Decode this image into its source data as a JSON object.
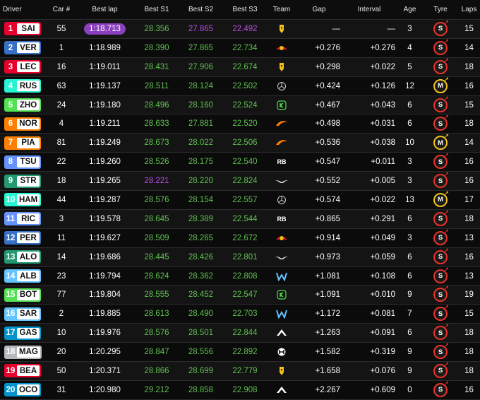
{
  "headers": {
    "driver": "Driver",
    "car": "Car #",
    "best_lap": "Best lap",
    "best_s1": "Best S1",
    "best_s2": "Best S2",
    "best_s3": "Best S3",
    "team": "Team",
    "gap": "Gap",
    "interval": "Interval",
    "age": "Age",
    "tyre": "Tyre",
    "laps": "Laps"
  },
  "team_colors": {
    "ferrari": "#e8002d",
    "redbull": "#3671c6",
    "mercedes": "#27f4d2",
    "sauber": "#52e252",
    "mclaren": "#ff8000",
    "rb": "#6692ff",
    "aston": "#229971",
    "williams": "#64c4ff",
    "alpine": "#0093cc",
    "haas": "#b6babd"
  },
  "rows": [
    {
      "pos": "1",
      "code": "SAI",
      "team": "ferrari",
      "team_icon": "ferrari-icon",
      "car": "55",
      "lap": "1:18.713",
      "lap_fastest": true,
      "s1": "28.356",
      "s1_c": "green",
      "s2": "27.865",
      "s2_c": "purple",
      "s3": "22.492",
      "s3_c": "purple",
      "gap": "—",
      "interval": "—",
      "age": "3",
      "tyre": "S",
      "tyre_type": "soft",
      "laps": "15"
    },
    {
      "pos": "2",
      "code": "VER",
      "team": "redbull",
      "team_icon": "redbull-icon",
      "car": "1",
      "lap": "1:18.989",
      "lap_fastest": false,
      "s1": "28.390",
      "s1_c": "green",
      "s2": "27.865",
      "s2_c": "green",
      "s3": "22.734",
      "s3_c": "green",
      "gap": "+0.276",
      "interval": "+0.276",
      "age": "4",
      "tyre": "S",
      "tyre_type": "soft",
      "laps": "14"
    },
    {
      "pos": "3",
      "code": "LEC",
      "team": "ferrari",
      "team_icon": "ferrari-icon",
      "car": "16",
      "lap": "1:19.011",
      "lap_fastest": false,
      "s1": "28.431",
      "s1_c": "green",
      "s2": "27.906",
      "s2_c": "green",
      "s3": "22.674",
      "s3_c": "green",
      "gap": "+0.298",
      "interval": "+0.022",
      "age": "5",
      "tyre": "S",
      "tyre_type": "soft",
      "laps": "18"
    },
    {
      "pos": "4",
      "code": "RUS",
      "team": "mercedes",
      "team_icon": "mercedes-icon",
      "car": "63",
      "lap": "1:19.137",
      "lap_fastest": false,
      "s1": "28.511",
      "s1_c": "green",
      "s2": "28.124",
      "s2_c": "green",
      "s3": "22.502",
      "s3_c": "green",
      "gap": "+0.424",
      "interval": "+0.126",
      "age": "12",
      "tyre": "M",
      "tyre_type": "medium",
      "laps": "16"
    },
    {
      "pos": "5",
      "code": "ZHO",
      "team": "sauber",
      "team_icon": "sauber-icon",
      "car": "24",
      "lap": "1:19.180",
      "lap_fastest": false,
      "s1": "28.496",
      "s1_c": "green",
      "s2": "28.160",
      "s2_c": "green",
      "s3": "22.524",
      "s3_c": "green",
      "gap": "+0.467",
      "interval": "+0.043",
      "age": "6",
      "tyre": "S",
      "tyre_type": "soft",
      "laps": "15"
    },
    {
      "pos": "6",
      "code": "NOR",
      "team": "mclaren",
      "team_icon": "mclaren-icon",
      "car": "4",
      "lap": "1:19.211",
      "lap_fastest": false,
      "s1": "28.633",
      "s1_c": "green",
      "s2": "27.881",
      "s2_c": "green",
      "s3": "22.520",
      "s3_c": "green",
      "gap": "+0.498",
      "interval": "+0.031",
      "age": "6",
      "tyre": "S",
      "tyre_type": "soft",
      "laps": "18"
    },
    {
      "pos": "7",
      "code": "PIA",
      "team": "mclaren",
      "team_icon": "mclaren-icon",
      "car": "81",
      "lap": "1:19.249",
      "lap_fastest": false,
      "s1": "28.673",
      "s1_c": "green",
      "s2": "28.022",
      "s2_c": "green",
      "s3": "22.506",
      "s3_c": "green",
      "gap": "+0.536",
      "interval": "+0.038",
      "age": "10",
      "tyre": "M",
      "tyre_type": "medium",
      "laps": "14"
    },
    {
      "pos": "8",
      "code": "TSU",
      "team": "rb",
      "team_icon": "rb-icon",
      "car": "22",
      "lap": "1:19.260",
      "lap_fastest": false,
      "s1": "28.526",
      "s1_c": "green",
      "s2": "28.175",
      "s2_c": "green",
      "s3": "22.540",
      "s3_c": "green",
      "gap": "+0.547",
      "interval": "+0.011",
      "age": "3",
      "tyre": "S",
      "tyre_type": "soft",
      "laps": "16"
    },
    {
      "pos": "9",
      "code": "STR",
      "team": "aston",
      "team_icon": "aston-martin-icon",
      "car": "18",
      "lap": "1:19.265",
      "lap_fastest": false,
      "s1": "28.221",
      "s1_c": "purple",
      "s2": "28.220",
      "s2_c": "green",
      "s3": "22.824",
      "s3_c": "green",
      "gap": "+0.552",
      "interval": "+0.005",
      "age": "3",
      "tyre": "S",
      "tyre_type": "soft",
      "laps": "16"
    },
    {
      "pos": "10",
      "code": "HAM",
      "team": "mercedes",
      "team_icon": "mercedes-icon",
      "car": "44",
      "lap": "1:19.287",
      "lap_fastest": false,
      "s1": "28.576",
      "s1_c": "green",
      "s2": "28.154",
      "s2_c": "green",
      "s3": "22.557",
      "s3_c": "green",
      "gap": "+0.574",
      "interval": "+0.022",
      "age": "13",
      "tyre": "M",
      "tyre_type": "medium",
      "laps": "17"
    },
    {
      "pos": "11",
      "code": "RIC",
      "team": "rb",
      "team_icon": "rb-icon",
      "car": "3",
      "lap": "1:19.578",
      "lap_fastest": false,
      "s1": "28.645",
      "s1_c": "green",
      "s2": "28.389",
      "s2_c": "green",
      "s3": "22.544",
      "s3_c": "green",
      "gap": "+0.865",
      "interval": "+0.291",
      "age": "6",
      "tyre": "S",
      "tyre_type": "soft",
      "laps": "18"
    },
    {
      "pos": "12",
      "code": "PER",
      "team": "redbull",
      "team_icon": "redbull-icon",
      "car": "11",
      "lap": "1:19.627",
      "lap_fastest": false,
      "s1": "28.509",
      "s1_c": "green",
      "s2": "28.265",
      "s2_c": "green",
      "s3": "22.672",
      "s3_c": "green",
      "gap": "+0.914",
      "interval": "+0.049",
      "age": "3",
      "tyre": "S",
      "tyre_type": "soft",
      "laps": "13"
    },
    {
      "pos": "13",
      "code": "ALO",
      "team": "aston",
      "team_icon": "aston-martin-icon",
      "car": "14",
      "lap": "1:19.686",
      "lap_fastest": false,
      "s1": "28.445",
      "s1_c": "green",
      "s2": "28.426",
      "s2_c": "green",
      "s3": "22.801",
      "s3_c": "green",
      "gap": "+0.973",
      "interval": "+0.059",
      "age": "6",
      "tyre": "S",
      "tyre_type": "soft",
      "laps": "16"
    },
    {
      "pos": "14",
      "code": "ALB",
      "team": "williams",
      "team_icon": "williams-icon",
      "car": "23",
      "lap": "1:19.794",
      "lap_fastest": false,
      "s1": "28.624",
      "s1_c": "green",
      "s2": "28.362",
      "s2_c": "green",
      "s3": "22.808",
      "s3_c": "green",
      "gap": "+1.081",
      "interval": "+0.108",
      "age": "6",
      "tyre": "S",
      "tyre_type": "soft",
      "laps": "13"
    },
    {
      "pos": "15",
      "code": "BOT",
      "team": "sauber",
      "team_icon": "sauber-icon",
      "car": "77",
      "lap": "1:19.804",
      "lap_fastest": false,
      "s1": "28.555",
      "s1_c": "green",
      "s2": "28.452",
      "s2_c": "green",
      "s3": "22.547",
      "s3_c": "green",
      "gap": "+1.091",
      "interval": "+0.010",
      "age": "9",
      "tyre": "S",
      "tyre_type": "soft",
      "laps": "19"
    },
    {
      "pos": "16",
      "code": "SAR",
      "team": "williams",
      "team_icon": "williams-icon",
      "car": "2",
      "lap": "1:19.885",
      "lap_fastest": false,
      "s1": "28.613",
      "s1_c": "green",
      "s2": "28.490",
      "s2_c": "green",
      "s3": "22.703",
      "s3_c": "green",
      "gap": "+1.172",
      "interval": "+0.081",
      "age": "7",
      "tyre": "S",
      "tyre_type": "soft",
      "laps": "15"
    },
    {
      "pos": "17",
      "code": "GAS",
      "team": "alpine",
      "team_icon": "alpine-icon",
      "car": "10",
      "lap": "1:19.976",
      "lap_fastest": false,
      "s1": "28.576",
      "s1_c": "green",
      "s2": "28.501",
      "s2_c": "green",
      "s3": "22.844",
      "s3_c": "green",
      "gap": "+1.263",
      "interval": "+0.091",
      "age": "6",
      "tyre": "S",
      "tyre_type": "soft",
      "laps": "18"
    },
    {
      "pos": "18",
      "code": "MAG",
      "team": "haas",
      "team_icon": "haas-icon",
      "car": "20",
      "lap": "1:20.295",
      "lap_fastest": false,
      "s1": "28.847",
      "s1_c": "green",
      "s2": "28.556",
      "s2_c": "green",
      "s3": "22.892",
      "s3_c": "green",
      "gap": "+1.582",
      "interval": "+0.319",
      "age": "9",
      "tyre": "S",
      "tyre_type": "soft",
      "laps": "18"
    },
    {
      "pos": "19",
      "code": "BEA",
      "team": "ferrari",
      "team_icon": "ferrari-icon",
      "car": "50",
      "lap": "1:20.371",
      "lap_fastest": false,
      "s1": "28.866",
      "s1_c": "green",
      "s2": "28.699",
      "s2_c": "green",
      "s3": "22.779",
      "s3_c": "green",
      "gap": "+1.658",
      "interval": "+0.076",
      "age": "9",
      "tyre": "S",
      "tyre_type": "soft",
      "laps": "18"
    },
    {
      "pos": "20",
      "code": "OCO",
      "team": "alpine",
      "team_icon": "alpine-icon",
      "car": "31",
      "lap": "1:20.980",
      "lap_fastest": false,
      "s1": "29.212",
      "s1_c": "green",
      "s2": "28.858",
      "s2_c": "green",
      "s3": "22.908",
      "s3_c": "green",
      "gap": "+2.267",
      "interval": "+0.609",
      "age": "0",
      "tyre": "S",
      "tyre_type": "soft",
      "laps": "16"
    }
  ]
}
